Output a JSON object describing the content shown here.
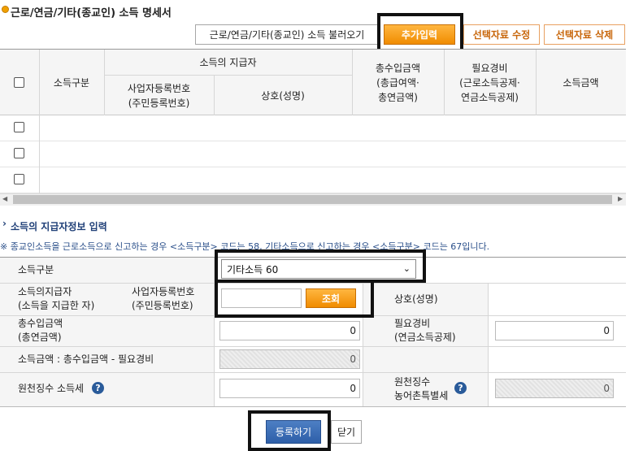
{
  "header": {
    "title": "근로/연금/기타(종교인) 소득 명세서",
    "buttons": {
      "import": "근로/연금/기타(종교인) 소득 불러오기",
      "add": "추가입력",
      "edit": "선택자료 수정",
      "delete": "선택자료 삭제"
    }
  },
  "table": {
    "col_income_type": "소득구분",
    "col_payer_group": "소득의 지급자",
    "col_biz_no": "사업자등록번호\n(주민등록번호)",
    "col_name": "상호(성명)",
    "col_total": "총수입금액\n(총급여액·\n총연금액)",
    "col_expense": "필요경비\n(근로소득공제·\n연금소득공제)",
    "col_income_amount": "소득금액",
    "rows": 3
  },
  "form": {
    "section_title": "소득의 지급자정보 입력",
    "notice": "※ 종교인소득을 근로소득으로 신고하는 경우 <소득구분> 코드는 58, 기타소득으로 신고하는 경우 <소득구분> 코드는 67입니다.",
    "income_type_label": "소득구분",
    "income_type_value": "기타소득 60",
    "payer_label": "소득의지급자\n(소득을 지급한 자)",
    "biz_no_label": "사업자등록번호\n(주민등록번호)",
    "search_button": "조회",
    "name_label": "상호(성명)",
    "total_label": "총수입금액\n(총연금액)",
    "total_value": "0",
    "expense_label": "필요경비\n(연금소득공제)",
    "expense_value": "0",
    "income_amount_label": "소득금액 : 총수입금액 - 필요경비",
    "income_amount_value": "0",
    "withholding_label": "원천징수 소득세",
    "withholding_value": "0",
    "rural_tax_label": "원천징수\n농어촌특별세",
    "rural_tax_value": "0"
  },
  "footer": {
    "register": "등록하기",
    "close": "닫기"
  }
}
